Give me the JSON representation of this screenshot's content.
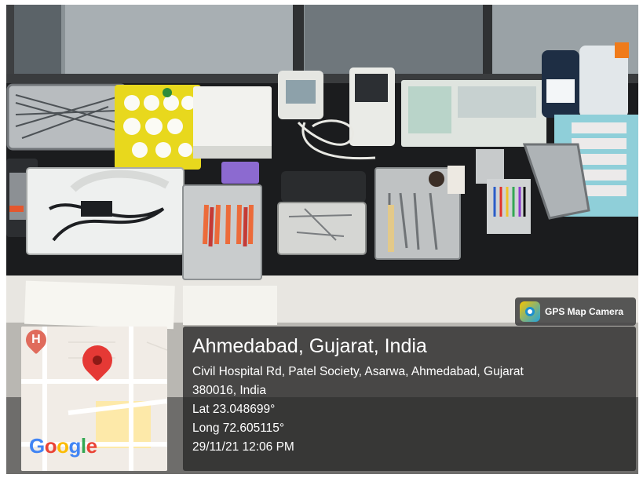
{
  "badge": {
    "label": "GPS Map Camera",
    "icon": "gps-map-camera-icon"
  },
  "location": {
    "title": "Ahmedabad, Gujarat, India",
    "address_line1": "Civil Hospital Rd, Patel Society, Asarwa, Ahmedabad, Gujarat",
    "address_line2": "380016, India",
    "lat": "Lat 23.048699°",
    "long": "Long 72.605115°",
    "datetime": "29/11/21 12:06 PM"
  },
  "map": {
    "logo": {
      "G": "G",
      "o1": "o",
      "o2": "o",
      "g": "g",
      "l": "l",
      "e": "e"
    },
    "hospital_marker": "H",
    "colors": {
      "pin": "#e53935",
      "hospital": "#e06b5c",
      "roads": "#ffffff",
      "land": "#f1ece6",
      "block": "#fde9a9"
    }
  }
}
